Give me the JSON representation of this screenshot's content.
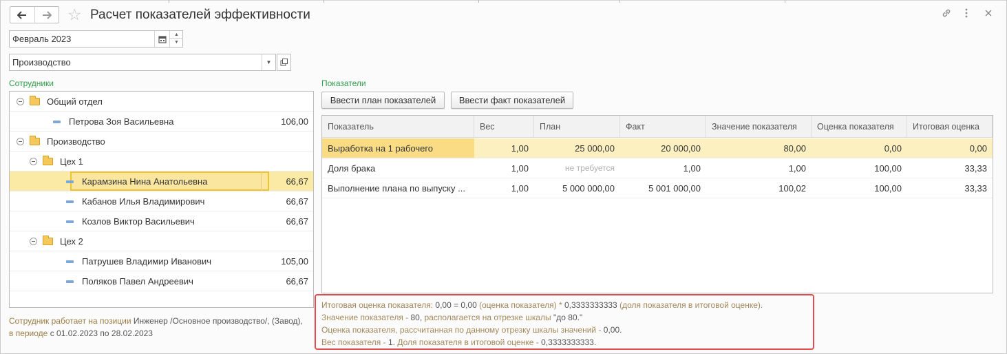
{
  "window": {
    "title": "Расчет показателей эффективности"
  },
  "header": {
    "back_icon": "arrow-left-icon",
    "forward_icon": "arrow-right-icon",
    "favorite_icon": "star-icon",
    "link_icon": "link-icon",
    "more_icon": "more-vertical-icon",
    "close_icon": "close-icon"
  },
  "period": {
    "value": "Февраль 2023"
  },
  "department": {
    "value": "Производство"
  },
  "employees": {
    "label": "Сотрудники",
    "rows": [
      {
        "type": "group",
        "level": 0,
        "name": "Общий отдел",
        "value": ""
      },
      {
        "type": "item",
        "level": 1,
        "name": "Петрова Зоя Васильевна",
        "value": "106,00"
      },
      {
        "type": "group",
        "level": 0,
        "name": "Производство",
        "value": ""
      },
      {
        "type": "group",
        "level": 1,
        "name": "Цех 1",
        "value": ""
      },
      {
        "type": "item",
        "level": 2,
        "name": "Карамзина Нина Анатольевна",
        "value": "66,67",
        "selected": true
      },
      {
        "type": "item",
        "level": 2,
        "name": "Кабанов Илья Владимирович",
        "value": "66,67"
      },
      {
        "type": "item",
        "level": 2,
        "name": "Козлов Виктор Васильевич",
        "value": "66,67"
      },
      {
        "type": "group",
        "level": 1,
        "name": "Цех 2",
        "value": ""
      },
      {
        "type": "item",
        "level": 2,
        "name": "Патрушев Владимир Иванович",
        "value": "105,00"
      },
      {
        "type": "item",
        "level": 2,
        "name": "Поляков Павел Андреевич",
        "value": "66,67"
      }
    ],
    "note": {
      "p1": "Сотрудник работает на позиции",
      "p2": "Инженер /Основное производство/, (Завод),",
      "p3": "в периоде",
      "p4": "с 01.02.2023 по 28.02.2023"
    }
  },
  "indicators": {
    "label": "Показатели",
    "btn_plan": "Ввести план показателей",
    "btn_fact": "Ввести факт показателей",
    "columns": [
      "Показатель",
      "Вес",
      "План",
      "Факт",
      "Значение показателя",
      "Оценка показателя",
      "Итоговая оценка"
    ],
    "rows": [
      {
        "name": "Выработка на 1 рабочего",
        "weight": "1,00",
        "plan": "25 000,00",
        "fact": "20 000,00",
        "value": "80,00",
        "score": "0,00",
        "total": "0,00",
        "selected": true
      },
      {
        "name": "Доля брака",
        "weight": "1,00",
        "plan": "не требуется",
        "plan_na": true,
        "fact": "1,00",
        "value": "1,00",
        "score": "100,00",
        "total": "33,33"
      },
      {
        "name": "Выполнение плана по выпуску ...",
        "weight": "1,00",
        "plan": "5 000 000,00",
        "fact": "5 001 000,00",
        "value": "100,02",
        "score": "100,00",
        "total": "33,33"
      }
    ]
  },
  "info": {
    "l1a": "Итоговая оценка показателя:",
    "l1b": "0,00 = 0,00",
    "l1c": "(оценка показателя) *",
    "l1d": "0,3333333333",
    "l1e": "(доля показателя в итоговой оценке).",
    "l2a": "Значение показателя -",
    "l2b": "80,",
    "l2c": "располагается на отрезке шкалы",
    "l2d": "\"до 80.\"",
    "l3a": "Оценка показателя, рассчитанная по данному отрезку шкалы значений -",
    "l3b": "0,00.",
    "l4a": "Вес показателя -",
    "l4b": "1.",
    "l4c": "Доля показателя в итоговой оценке -",
    "l4d": "0,3333333333."
  }
}
